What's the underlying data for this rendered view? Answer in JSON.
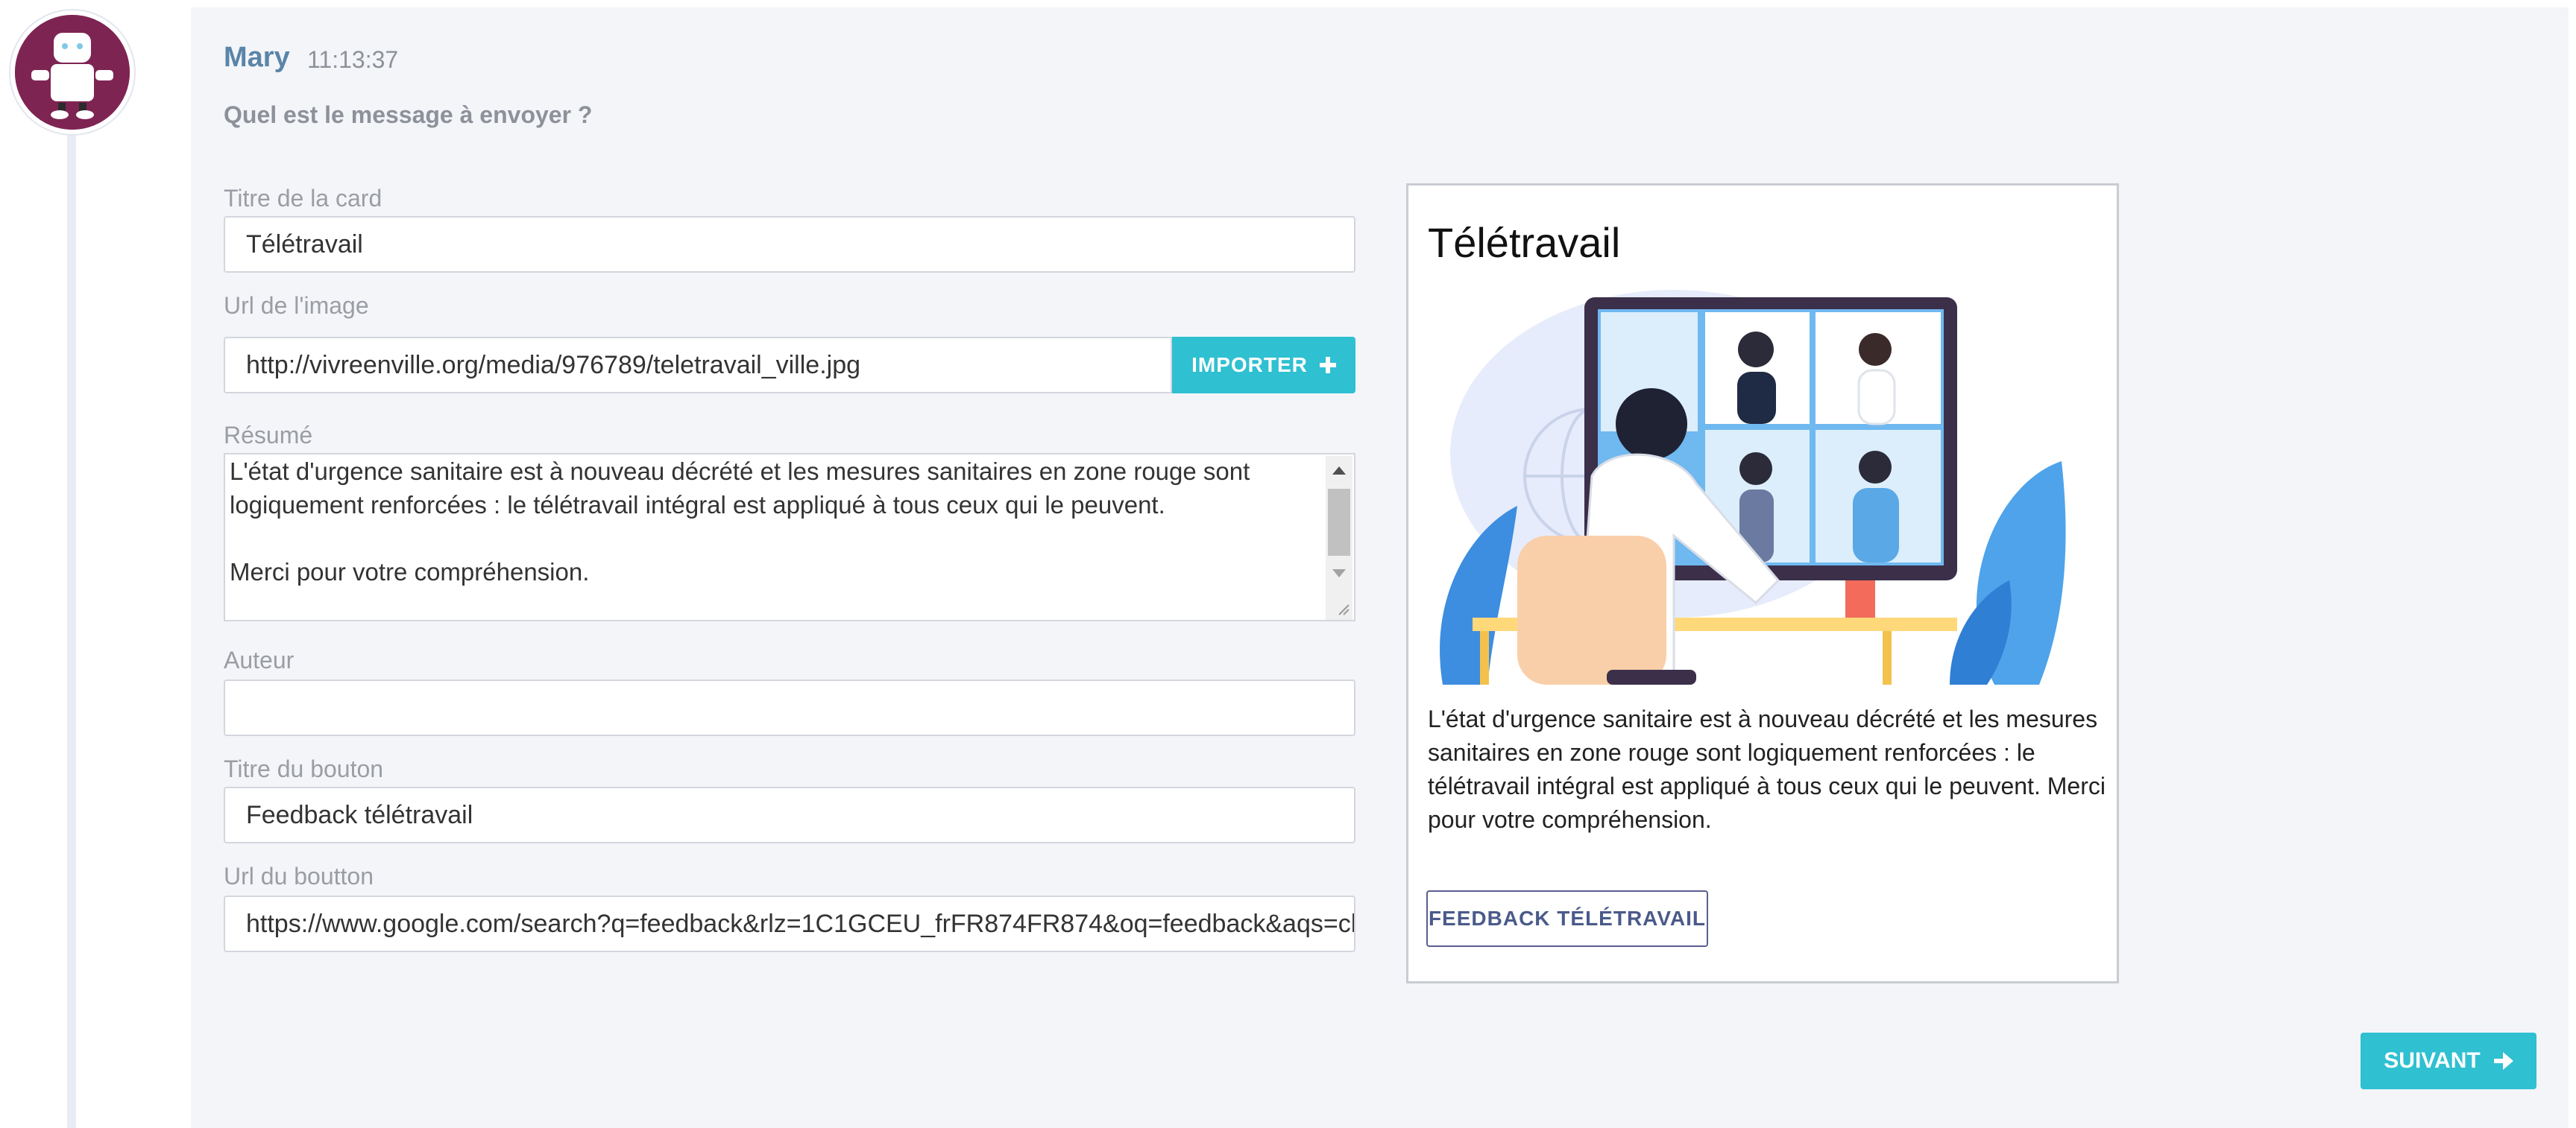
{
  "message": {
    "sender": "Mary",
    "time": "11:13:37",
    "question": "Quel est le message à envoyer ?"
  },
  "form": {
    "card_title_label": "Titre de la card",
    "card_title_value": "Télétravail",
    "image_url_label": "Url de l'image",
    "image_url_value": "http://vivreenville.org/media/976789/teletravail_ville.jpg",
    "import_button_label": "IMPORTER",
    "summary_label": "Résumé",
    "summary_line1": "L'état d'urgence sanitaire est à nouveau décrété et les mesures sanitaires en zone rouge sont",
    "summary_line2": "logiquement renforcées : le télétravail intégral est appliqué à tous ceux qui le peuvent.",
    "summary_line3": "Merci pour votre compréhension.",
    "author_label": "Auteur",
    "author_value": "",
    "button_title_label": "Titre du bouton",
    "button_title_value": "Feedback télétravail",
    "button_url_label": "Url du boutton",
    "button_url_value": "https://www.google.com/search?q=feedback&rlz=1C1GCEU_frFR874FR874&oq=feedback&aqs=chrome"
  },
  "preview": {
    "title": "Télétravail",
    "text": "L'état d'urgence sanitaire est à nouveau décrété et les mesures sanitaires en zone rouge sont logiquement renforcées : le télétravail intégral est appliqué à tous ceux qui le peuvent. Merci pour votre compréhension.",
    "button_label": "FEEDBACK TÉLÉTRAVAIL"
  },
  "next_button_label": "SUIVANT",
  "icons": [
    "robot-avatar-icon",
    "plus-icon",
    "arrow-right-icon"
  ],
  "colors": {
    "accent": "#2fc0d1",
    "avatar_bg": "#7e2453",
    "sender_name": "#5a85a8",
    "panel_bg": "#f4f5f9"
  }
}
